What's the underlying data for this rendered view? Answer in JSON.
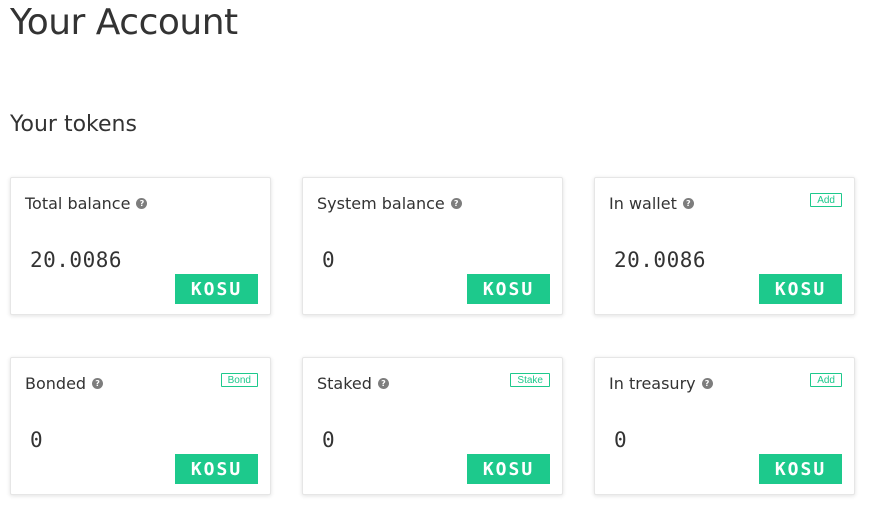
{
  "page": {
    "title": "Your Account"
  },
  "section": {
    "title": "Your tokens"
  },
  "cards": [
    {
      "label": "Total balance",
      "value": "20.0086",
      "unit": "KOSU",
      "action": null
    },
    {
      "label": "System balance",
      "value": "0",
      "unit": "KOSU",
      "action": null
    },
    {
      "label": "In wallet",
      "value": "20.0086",
      "unit": "KOSU",
      "action": "Add"
    },
    {
      "label": "Bonded",
      "value": "0",
      "unit": "KOSU",
      "action": "Bond"
    },
    {
      "label": "Staked",
      "value": "0",
      "unit": "KOSU",
      "action": "Stake"
    },
    {
      "label": "In treasury",
      "value": "0",
      "unit": "KOSU",
      "action": "Add"
    }
  ],
  "help_icon": {
    "glyph": "?",
    "name": "help-icon"
  },
  "colors": {
    "accent": "#1dc98c",
    "help_icon": "#7d7d7d",
    "text": "#333333"
  }
}
